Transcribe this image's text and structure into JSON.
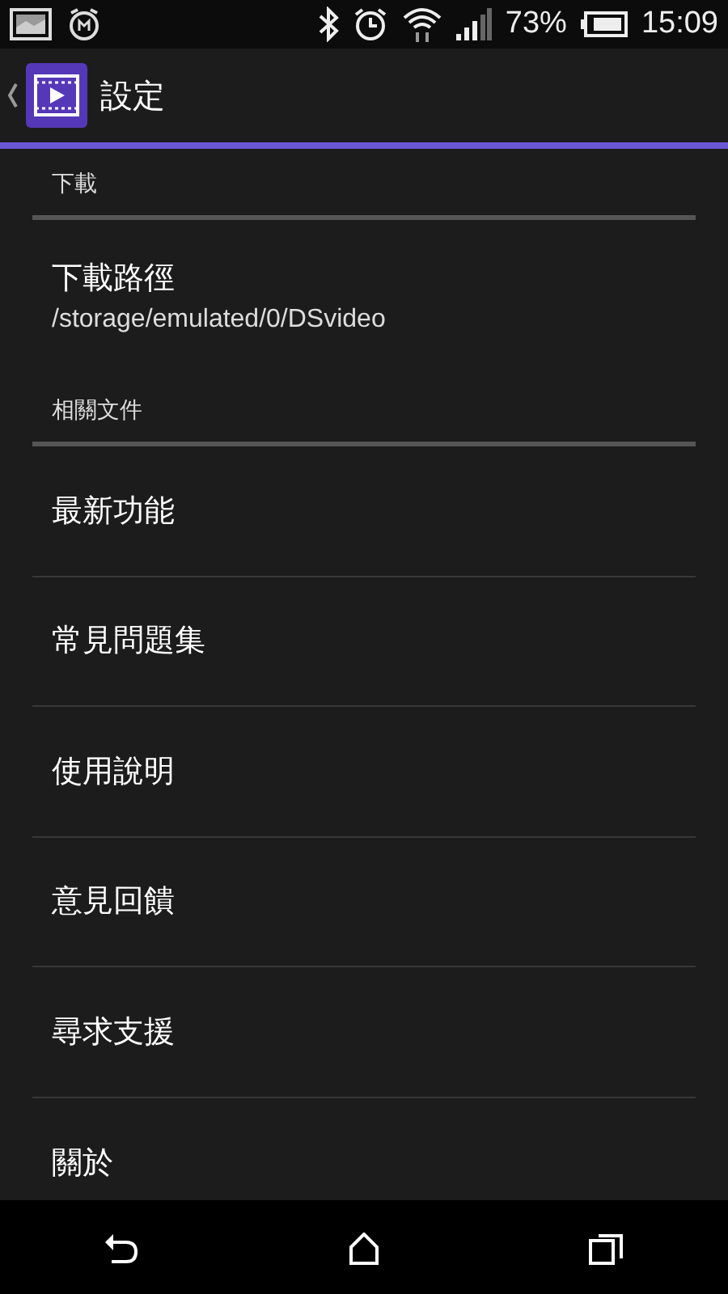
{
  "status_bar": {
    "battery_text": "73%",
    "time": "15:09"
  },
  "action_bar": {
    "title": "設定"
  },
  "sections": [
    {
      "title": "下載",
      "items": [
        {
          "title": "下載路徑",
          "summary": "/storage/emulated/0/DSvideo"
        }
      ]
    },
    {
      "title": "相關文件",
      "items": [
        {
          "title": "最新功能"
        },
        {
          "title": "常見問題集"
        },
        {
          "title": "使用說明"
        },
        {
          "title": "意見回饋"
        },
        {
          "title": "尋求支援"
        },
        {
          "title": "關於"
        }
      ]
    }
  ]
}
